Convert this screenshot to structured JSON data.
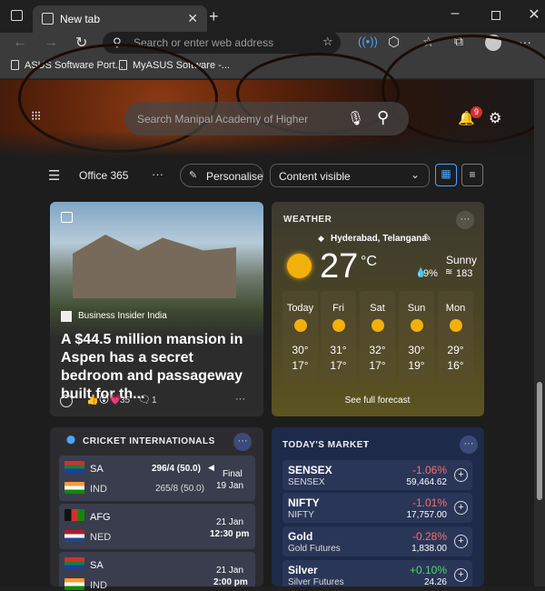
{
  "browser": {
    "tab_title": "New tab",
    "address_placeholder": "Search or enter web address",
    "bookmarks": [
      "ASUS Software Port...",
      "MyASUS Software -..."
    ]
  },
  "hero": {
    "search_placeholder": "Search Manipal Academy of Higher",
    "notification_count": "9"
  },
  "feedbar": {
    "office": "Office 365",
    "more": "···",
    "personalise": "Personalise",
    "content_select": "Content visible"
  },
  "news": {
    "source": "Business Insider India",
    "headline": "A $44.5 million mansion in Aspen has a secret bedroom and passageway built for th...",
    "reaction_count": "35",
    "comment_count": "1"
  },
  "weather": {
    "title": "WEATHER",
    "location": "Hyderabad, Telangana",
    "temp": "27",
    "unit": "°C",
    "condition": "Sunny",
    "precip": "9%",
    "aqi": "183",
    "forecast": [
      {
        "day": "Today",
        "high": "30°",
        "low": "17°"
      },
      {
        "day": "Fri",
        "high": "31°",
        "low": "17°"
      },
      {
        "day": "Sat",
        "high": "32°",
        "low": "17°"
      },
      {
        "day": "Sun",
        "high": "30°",
        "low": "19°"
      },
      {
        "day": "Mon",
        "high": "29°",
        "low": "16°"
      }
    ],
    "full_forecast": "See full forecast"
  },
  "cricket": {
    "title": "CRICKET INTERNATIONALS",
    "matches": [
      {
        "team1": "SA",
        "score1": "296/4 (50.0)",
        "team2": "IND",
        "score2": "265/8 (50.0)",
        "status": "Final",
        "date": "19 Jan"
      },
      {
        "team1": "AFG",
        "team2": "NED",
        "date": "21 Jan",
        "time": "12:30 pm"
      },
      {
        "team1": "SA",
        "team2": "IND",
        "date": "21 Jan",
        "time": "2:00 pm"
      }
    ]
  },
  "market": {
    "title": "TODAY'S MARKET",
    "rows": [
      {
        "name": "SENSEX",
        "sub": "SENSEX",
        "pct": "-1.06%",
        "value": "59,464.62",
        "color": "#ff6b6b"
      },
      {
        "name": "NIFTY",
        "sub": "NIFTY",
        "pct": "-1.01%",
        "value": "17,757.00",
        "color": "#ff6b6b"
      },
      {
        "name": "Gold",
        "sub": "Gold Futures",
        "pct": "-0.28%",
        "value": "1,838.00",
        "color": "#ff6b6b"
      },
      {
        "name": "Silver",
        "sub": "Silver Futures",
        "pct": "+0.10%",
        "value": "24.26",
        "color": "#4cd964"
      }
    ]
  }
}
